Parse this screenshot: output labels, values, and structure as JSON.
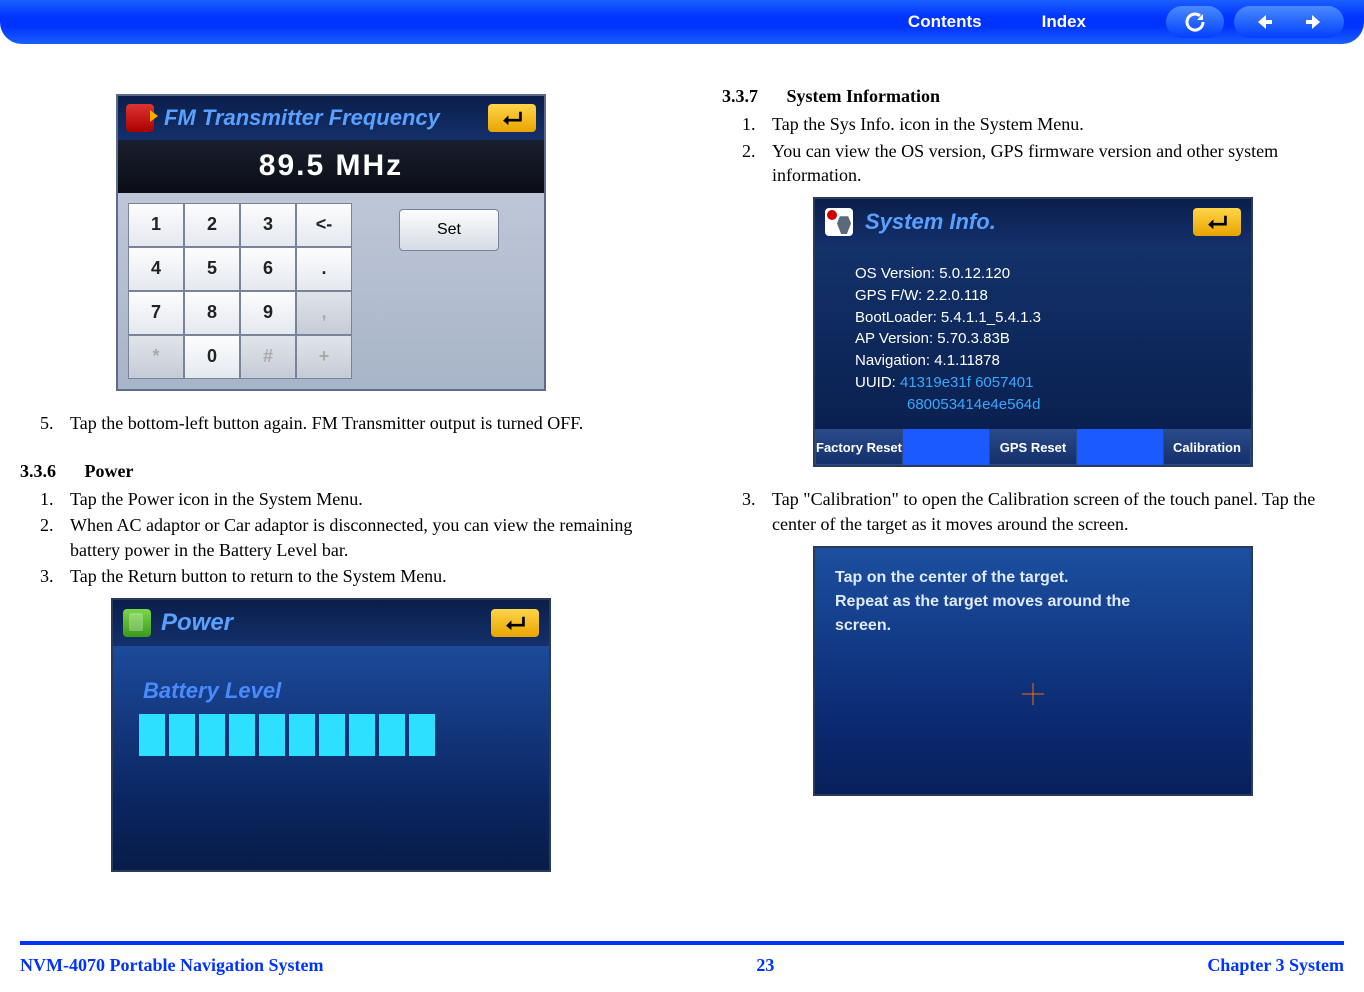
{
  "nav": {
    "contents": "Contents",
    "index": "Index"
  },
  "left": {
    "fm": {
      "title": "FM Transmitter Frequency",
      "freq": "89.5  MHz",
      "keys": [
        [
          "1",
          "2",
          "3",
          "<-"
        ],
        [
          "4",
          "5",
          "6",
          "."
        ],
        [
          "7",
          "8",
          "9",
          ","
        ],
        [
          "*",
          "0",
          "#",
          "+"
        ]
      ],
      "set": "Set"
    },
    "step5": "Tap the bottom-left button again. FM Transmitter output is turned OFF.",
    "sec336_num": "3.3.6",
    "sec336_title": "Power",
    "pw_steps": {
      "1": "Tap the Power icon in the System Menu.",
      "2": "When AC adaptor or Car adaptor is disconnected, you can view the remaining battery power in the Battery Level bar.",
      "3": "Tap the Return button to return to the System Menu."
    },
    "power": {
      "title": "Power",
      "battery_label": "Battery Level"
    }
  },
  "right": {
    "sec337_num": "3.3.7",
    "sec337_title": "System Information",
    "si_steps_a": {
      "1": "Tap the Sys Info. icon in the System Menu.",
      "2": "You can view the OS version, GPS firmware version and other system information."
    },
    "sysinfo": {
      "title": "System Info.",
      "lines": {
        "l1": "OS Version: 5.0.12.120",
        "l2": "GPS F/W: 2.2.0.118",
        "l3": "BootLoader: 5.4.1.1_5.4.1.3",
        "l4": "AP Version: 5.70.3.83B",
        "l5": "Navigation: 4.1.11878",
        "l6a": "UUID: ",
        "l6b": "41319e31f 6057401",
        "l7": "680053414e4e564d"
      },
      "btns": {
        "factory": "Factory Reset",
        "gps": "GPS Reset",
        "cal": "Calibration"
      }
    },
    "si_steps_b": {
      "3": "Tap \"Calibration\" to open the Calibration screen of the touch panel. Tap the center of the target as it moves around the screen."
    },
    "cal": {
      "line1": "Tap on the center of the target.",
      "line2": "Repeat as the target moves around the",
      "line3": "screen."
    }
  },
  "footer": {
    "left": "NVM-4070 Portable Navigation System",
    "center": "23",
    "right": "Chapter 3 System"
  }
}
